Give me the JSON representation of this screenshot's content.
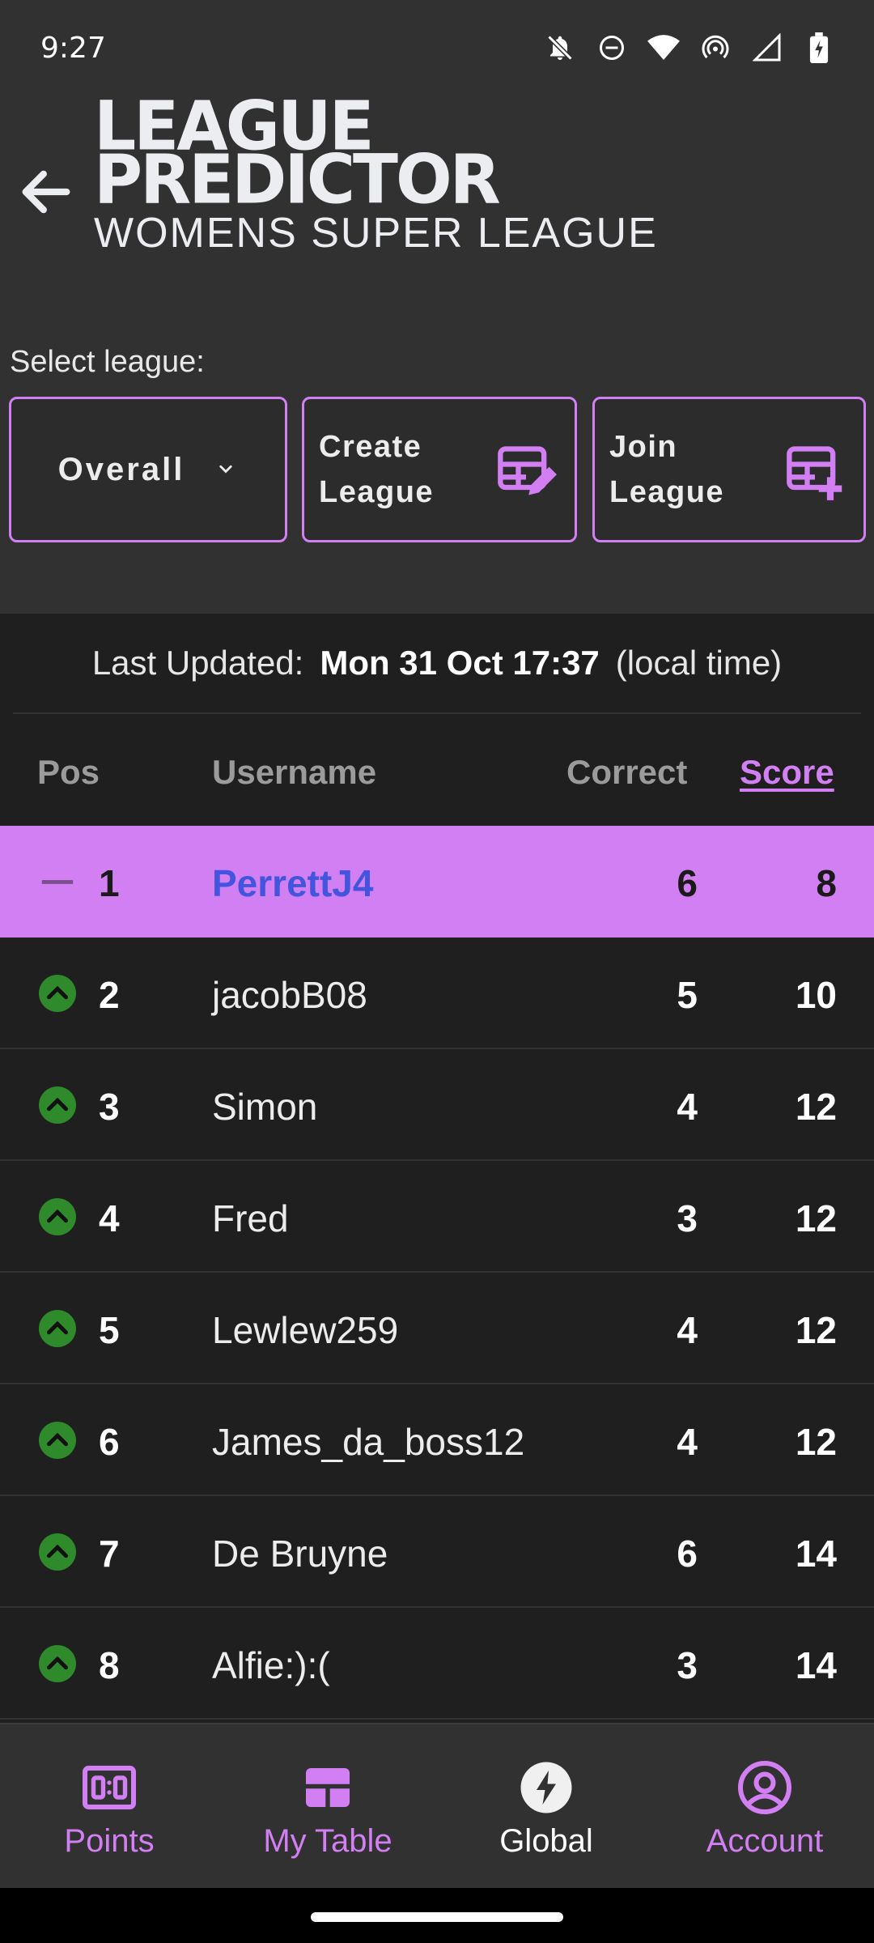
{
  "status_bar": {
    "time": "9:27",
    "icons": [
      "bell-off-icon",
      "do-not-disturb-icon",
      "wifi-icon",
      "hotspot-icon",
      "signal-icon",
      "battery-charging-icon"
    ]
  },
  "header": {
    "logo_line1": "LEAGUE",
    "logo_line2": "PREDICTOR",
    "logo_subtitle": "WOMENS SUPER LEAGUE",
    "back_icon": "arrow-left-icon"
  },
  "league_controls": {
    "select_label": "Select league:",
    "selected_league": "Overall",
    "create_label_line1": "Create",
    "create_label_line2": "League",
    "join_label_line1": "Join",
    "join_label_line2": "League"
  },
  "updated": {
    "prefix": "Last Updated:",
    "date": "Mon 31 Oct 17:37",
    "suffix": "(local time)"
  },
  "table": {
    "headers": {
      "pos": "Pos",
      "username": "Username",
      "correct": "Correct",
      "score": "Score"
    },
    "rows": [
      {
        "movement": "same",
        "pos": "1",
        "username": "PerrettJ4",
        "correct": "6",
        "score": "8",
        "highlight": true
      },
      {
        "movement": "up",
        "pos": "2",
        "username": "jacobB08",
        "correct": "5",
        "score": "10"
      },
      {
        "movement": "up",
        "pos": "3",
        "username": "Simon",
        "correct": "4",
        "score": "12"
      },
      {
        "movement": "up",
        "pos": "4",
        "username": "Fred",
        "correct": "3",
        "score": "12"
      },
      {
        "movement": "up",
        "pos": "5",
        "username": "Lewlew259",
        "correct": "4",
        "score": "12"
      },
      {
        "movement": "up",
        "pos": "6",
        "username": "James_da_boss12",
        "correct": "4",
        "score": "12"
      },
      {
        "movement": "up",
        "pos": "7",
        "username": "De Bruyne",
        "correct": "6",
        "score": "14"
      },
      {
        "movement": "up",
        "pos": "8",
        "username": "Alfie:):(",
        "correct": "3",
        "score": "14"
      }
    ]
  },
  "bottom_nav": {
    "items": [
      {
        "label": "Points",
        "icon": "scoreboard-icon"
      },
      {
        "label": "My Table",
        "icon": "table-icon"
      },
      {
        "label": "Global",
        "icon": "lightning-icon",
        "active": true
      },
      {
        "label": "Account",
        "icon": "account-circle-icon"
      }
    ]
  },
  "colors": {
    "accent": "#d17ff2",
    "highlight_username": "#4355de",
    "up_arrow": "#2f8a2b",
    "header_bg": "#313131",
    "table_bg": "#1f1f1f"
  }
}
